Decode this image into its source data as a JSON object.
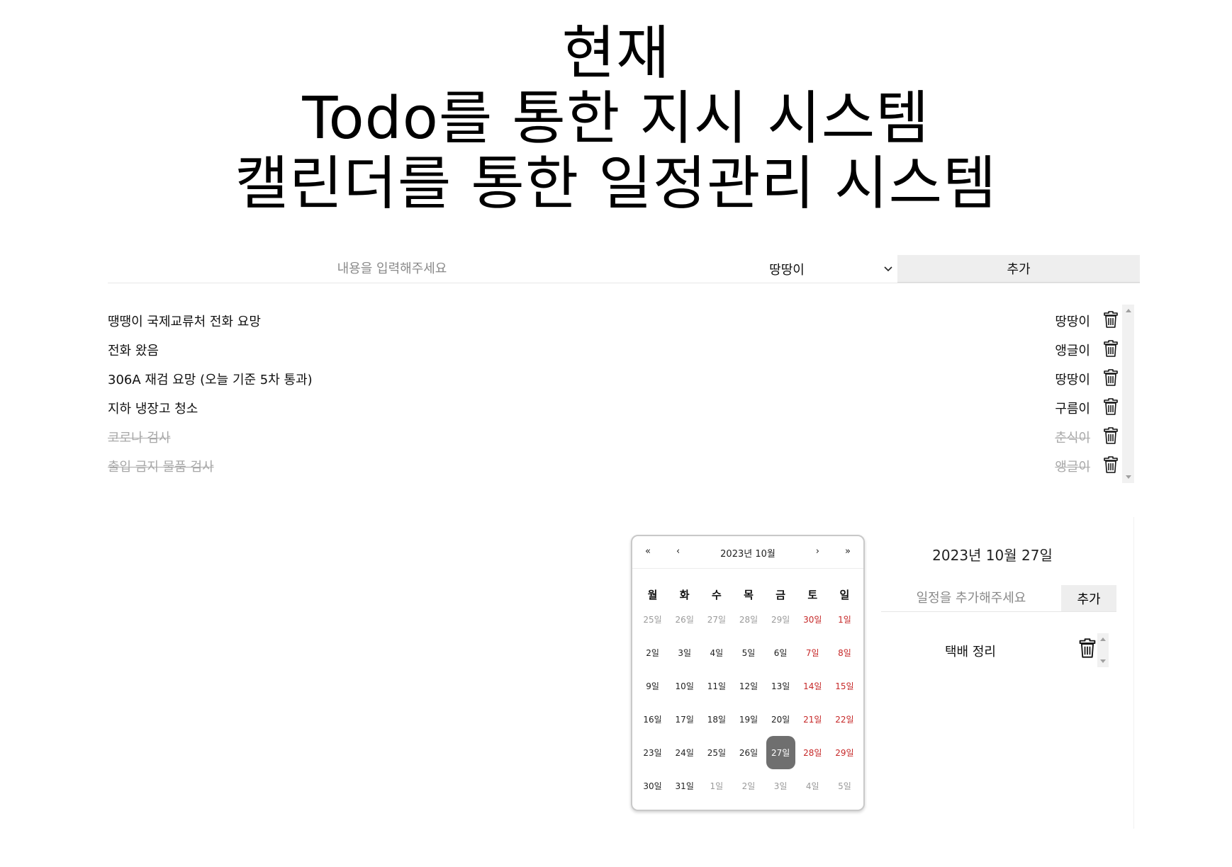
{
  "hero": {
    "lines": [
      "현재",
      "Todo를 통한 지시 시스템",
      "캘린더를 통한 일정관리 시스템"
    ]
  },
  "todo_form": {
    "placeholder": "내용을 입력해주세요",
    "selected_assignee": "땅땅이",
    "add_label": "추가"
  },
  "todos": [
    {
      "text": "땡땡이 국제교류처 전화 요망",
      "owner": "땅땅이",
      "done": false
    },
    {
      "text": "전화 왔음",
      "owner": "앵글이",
      "done": false
    },
    {
      "text": "306A 재검 요망 (오늘 기준 5차 통과)",
      "owner": "땅땅이",
      "done": false
    },
    {
      "text": "지하 냉장고 청소",
      "owner": "구름이",
      "done": false
    },
    {
      "text": "코로나 검사",
      "owner": "춘식이",
      "done": true
    },
    {
      "text": "출입 금지 물품 검사",
      "owner": "앵글이",
      "done": true
    }
  ],
  "calendar": {
    "nav": {
      "prev2": "«",
      "prev": "‹",
      "label": "2023년 10월",
      "next": "›",
      "next2": "»"
    },
    "weekdays": [
      "월",
      "화",
      "수",
      "목",
      "금",
      "토",
      "일"
    ],
    "weeks": [
      [
        {
          "d": "25일",
          "out": true
        },
        {
          "d": "26일",
          "out": true
        },
        {
          "d": "27일",
          "out": true
        },
        {
          "d": "28일",
          "out": true
        },
        {
          "d": "29일",
          "out": true
        },
        {
          "d": "30일",
          "out": true,
          "we": true
        },
        {
          "d": "1일",
          "we": true
        }
      ],
      [
        {
          "d": "2일"
        },
        {
          "d": "3일"
        },
        {
          "d": "4일"
        },
        {
          "d": "5일"
        },
        {
          "d": "6일"
        },
        {
          "d": "7일",
          "we": true
        },
        {
          "d": "8일",
          "we": true
        }
      ],
      [
        {
          "d": "9일"
        },
        {
          "d": "10일"
        },
        {
          "d": "11일"
        },
        {
          "d": "12일"
        },
        {
          "d": "13일"
        },
        {
          "d": "14일",
          "we": true
        },
        {
          "d": "15일",
          "we": true
        }
      ],
      [
        {
          "d": "16일"
        },
        {
          "d": "17일"
        },
        {
          "d": "18일"
        },
        {
          "d": "19일"
        },
        {
          "d": "20일"
        },
        {
          "d": "21일",
          "we": true
        },
        {
          "d": "22일",
          "we": true
        }
      ],
      [
        {
          "d": "23일"
        },
        {
          "d": "24일"
        },
        {
          "d": "25일"
        },
        {
          "d": "26일"
        },
        {
          "d": "27일",
          "sel": true
        },
        {
          "d": "28일",
          "we": true
        },
        {
          "d": "29일",
          "we": true
        }
      ],
      [
        {
          "d": "30일"
        },
        {
          "d": "31일"
        },
        {
          "d": "1일",
          "out": true
        },
        {
          "d": "2일",
          "out": true
        },
        {
          "d": "3일",
          "out": true
        },
        {
          "d": "4일",
          "out": true
        },
        {
          "d": "5일",
          "out": true
        }
      ]
    ],
    "colors": {
      "weekend": "#c62828",
      "selected_bg": "#6f6f6f",
      "outside_month": "#9a9a9a"
    }
  },
  "schedule": {
    "date_label": "2023년 10월 27일",
    "placeholder": "일정을 추가해주세요",
    "add_label": "추가",
    "items": [
      "택배 정리"
    ]
  },
  "icons": {
    "delete": "trash-icon",
    "dropdown": "chevron-down-icon"
  }
}
